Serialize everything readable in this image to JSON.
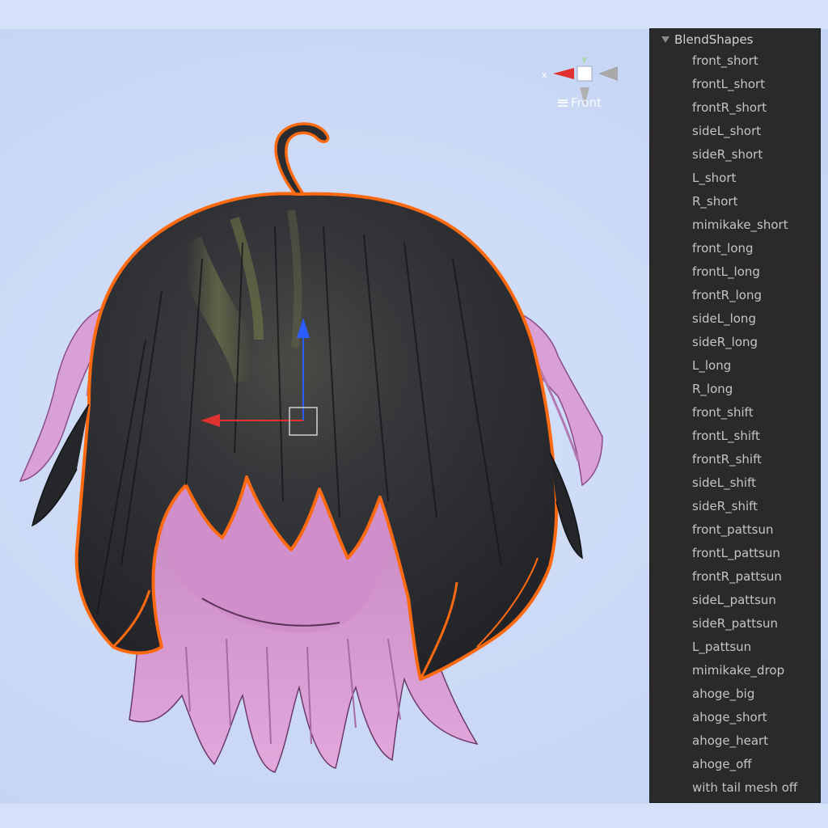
{
  "viewport": {
    "view_label": "Front",
    "gizmo_axis_label": "x",
    "gizmo_y_label": "y"
  },
  "blendshapes": {
    "header": "BlendShapes",
    "items": [
      "front_short",
      "frontL_short",
      "frontR_short",
      "sideL_short",
      "sideR_short",
      "L_short",
      "R_short",
      "mimikake_short",
      "front_long",
      "frontL_long",
      "frontR_long",
      "sideL_long",
      "sideR_long",
      "L_long",
      "R_long",
      "front_shift",
      "frontL_shift",
      "frontR_shift",
      "sideL_shift",
      "sideR_shift",
      "front_pattsun",
      "frontL_pattsun",
      "frontR_pattsun",
      "sideL_pattsun",
      "sideR_pattsun",
      "L_pattsun",
      "mimikake_drop",
      "ahoge_big",
      "ahoge_short",
      "ahoge_heart",
      "ahoge_off",
      "with tail mesh off"
    ]
  },
  "colors": {
    "background": "#d3dff8",
    "panel": "#2a2a2a",
    "hair_dark": "#2e2f33",
    "hair_pink": "#d79ad0",
    "selection_outline": "#ff6a10",
    "gizmo_x": "#e03030",
    "gizmo_y": "#2a5cff"
  },
  "icons": {
    "foldout": "triangle-down-icon",
    "view_menu": "hamburger-icon"
  }
}
